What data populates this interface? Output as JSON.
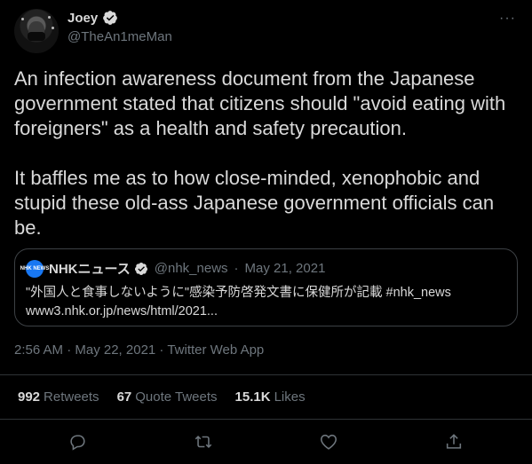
{
  "author": {
    "display_name": "Joey",
    "handle": "@TheAn1meMan"
  },
  "more_icon": "···",
  "tweet_text": "An infection awareness document from the Japanese government stated that citizens should \"avoid eating with foreigners\" as a health and safety precaution.\n\nIt baffles me as to how close-minded, xenophobic and stupid these old-ass Japanese government officials can be.",
  "quoted_tweet": {
    "logo_text": "NHK NEWS",
    "name": "NHKニュース",
    "handle": "@nhk_news",
    "separator": "·",
    "date": "May 21, 2021",
    "text_line1": "\"外国人と食事しないように\"感染予防啓発文書に保健所が記載 #nhk_news",
    "text_line2": "www3.nhk.or.jp/news/html/2021..."
  },
  "timestamp": "2:56 AM · May 22, 2021 · Twitter Web App",
  "stats": {
    "retweets_count": "992",
    "retweets_label": "Retweets",
    "quotes_count": "67",
    "quotes_label": "Quote Tweets",
    "likes_count": "15.1K",
    "likes_label": "Likes"
  },
  "actions": [
    "reply-icon",
    "retweet-icon",
    "like-icon",
    "share-icon"
  ],
  "colors": {
    "background": "#000000",
    "text": "#d9d9d9",
    "secondary": "#6e767d",
    "divider": "#2f3336",
    "verified": "#d9d9d9",
    "nhk_blue": "#1877f2"
  }
}
